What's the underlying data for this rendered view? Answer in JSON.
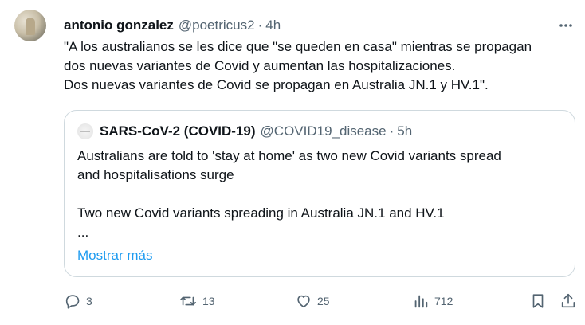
{
  "post": {
    "author_name": "antonio gonzalez",
    "author_handle": "@poetricus2",
    "separator": "·",
    "time": "4h",
    "text_lines": [
      "\"A los australianos se les dice que \"se queden en casa\" mientras se propagan",
      "dos nuevas variantes de Covid y aumentan las hospitalizaciones.",
      "Dos nuevas variantes de Covid se propagan en Australia JN.1 y HV.1\"."
    ]
  },
  "quote": {
    "author_name": "SARS-CoV-2 (COVID-19)",
    "author_handle": "@COVID19_disease",
    "separator": "·",
    "time": "5h",
    "text_lines": [
      "Australians are told to 'stay at home' as two new Covid variants spread",
      "and hospitalisations surge",
      "",
      "Two new Covid variants spreading in Australia JN.1 and HV.1",
      "..."
    ],
    "show_more": "Mostrar más"
  },
  "actions": {
    "replies": "3",
    "reposts": "13",
    "likes": "25",
    "views": "712"
  },
  "icons": [
    "more-icon",
    "reply-icon",
    "repost-icon",
    "like-icon",
    "views-icon",
    "bookmark-icon",
    "share-icon"
  ],
  "colors": {
    "text": "#0f1419",
    "secondary": "#536471",
    "link": "#1d9bf0",
    "border": "#cfd9de"
  }
}
